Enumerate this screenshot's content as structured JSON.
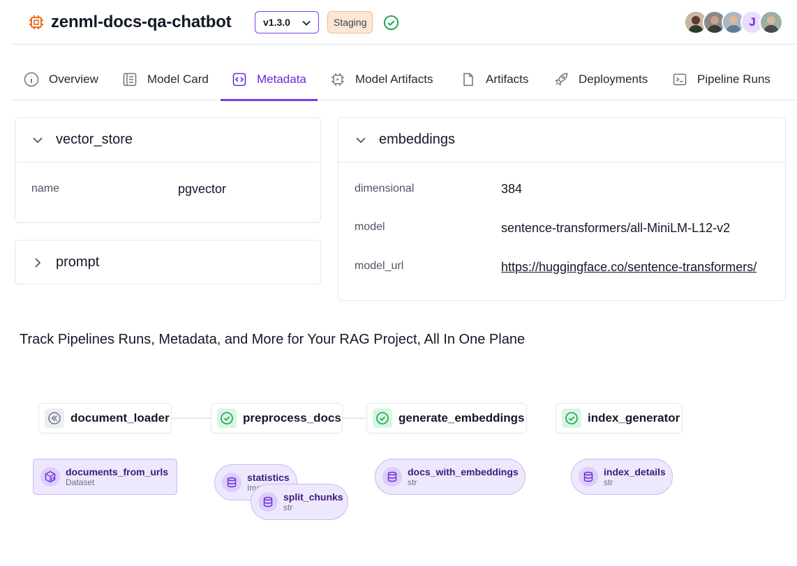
{
  "header": {
    "project_title": "zenml-docs-qa-chatbot",
    "version": "v1.3.0",
    "stage": "Staging",
    "avatar_initial": "J"
  },
  "tabs": [
    {
      "label": "Overview",
      "icon": "info-icon"
    },
    {
      "label": "Model Card",
      "icon": "document-icon"
    },
    {
      "label": "Metadata",
      "icon": "code-icon",
      "active": true
    },
    {
      "label": "Model Artifacts",
      "icon": "chip-icon"
    },
    {
      "label": "Artifacts",
      "icon": "file-icon"
    },
    {
      "label": "Deployments",
      "icon": "rocket-icon"
    },
    {
      "label": "Pipeline Runs",
      "icon": "terminal-icon"
    }
  ],
  "metadata": {
    "vector_store": {
      "title": "vector_store",
      "expanded": true,
      "rows": [
        {
          "key": "name",
          "value": "pgvector"
        }
      ]
    },
    "prompt": {
      "title": "prompt",
      "expanded": false
    },
    "embeddings": {
      "title": "embeddings",
      "expanded": true,
      "rows": [
        {
          "key": "dimensional",
          "value": "384"
        },
        {
          "key": "model",
          "value": "sentence-transformers/all-MiniLM-L12-v2"
        },
        {
          "key": "model_url",
          "value": "https://huggingface.co/sentence-transformers/"
        }
      ]
    }
  },
  "tagline": "Track Pipelines Runs, Metadata, and More for Your RAG Project, All In One Plane",
  "dag": {
    "steps": [
      {
        "name": "document_loader",
        "status": "cached"
      },
      {
        "name": "preprocess_docs",
        "status": "success"
      },
      {
        "name": "generate_embeddings",
        "status": "success"
      },
      {
        "name": "index_generator",
        "status": "success"
      }
    ],
    "artifacts": [
      {
        "name": "documents_from_urls",
        "type": "Dataset"
      },
      {
        "name": "statistics",
        "type": "Ima"
      },
      {
        "name": "split_chunks",
        "type": "str"
      },
      {
        "name": "docs_with_embeddings",
        "type": "str"
      },
      {
        "name": "index_details",
        "type": "str"
      }
    ]
  },
  "colors": {
    "accent": "#7c3aed",
    "success": "#16a34a",
    "staging_bg": "#fde7d2",
    "artifact_bg": "#ede8fc"
  }
}
